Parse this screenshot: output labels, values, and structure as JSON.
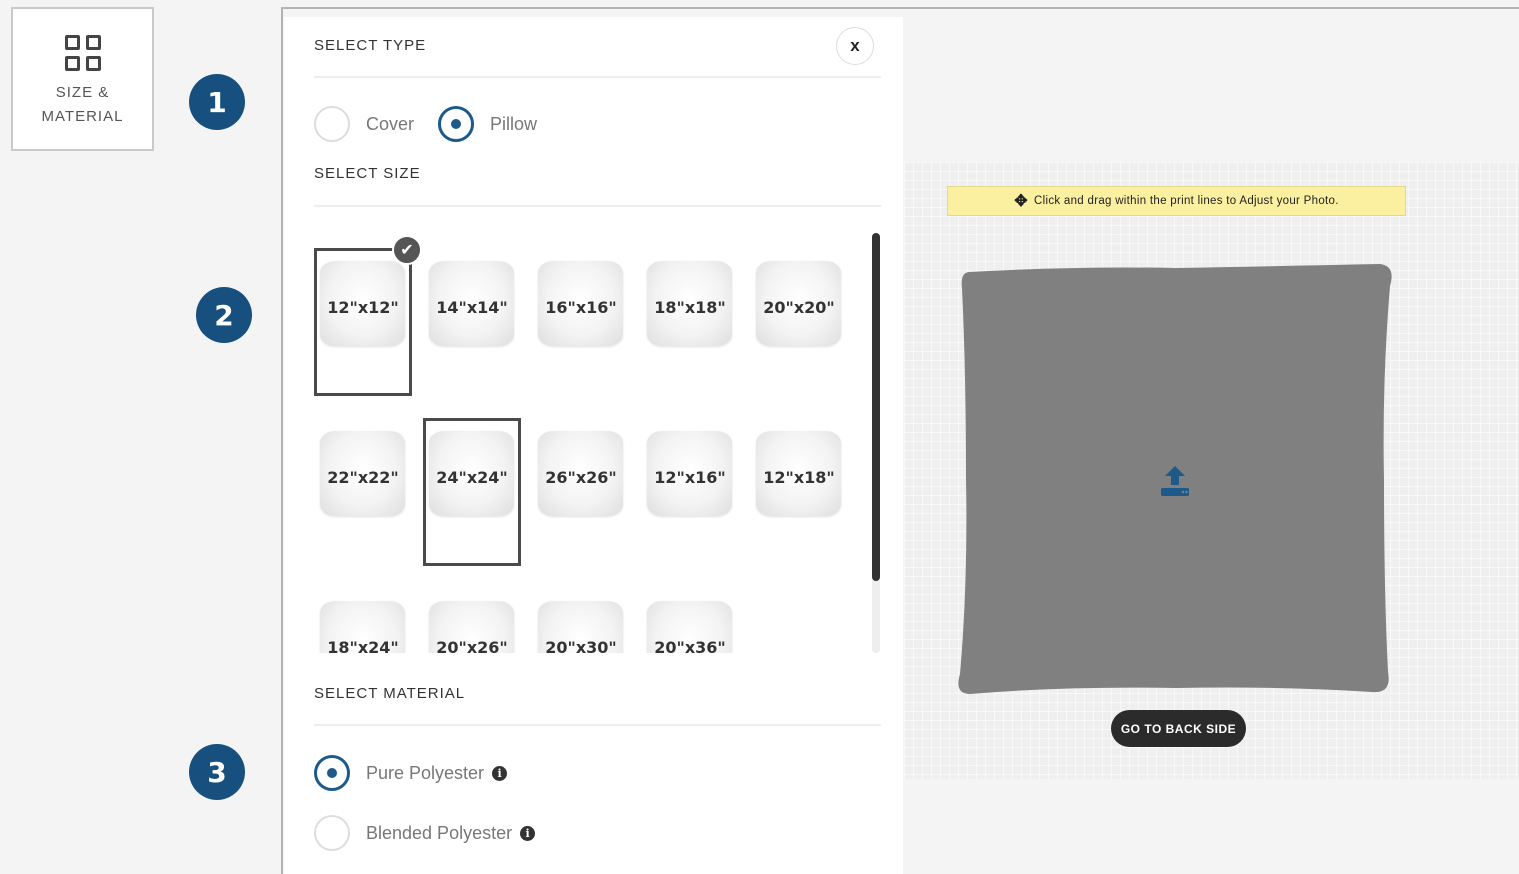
{
  "nav": {
    "size_material_label": "SIZE & MATERIAL",
    "icon": "grid-icon"
  },
  "steps": [
    "1",
    "2",
    "3"
  ],
  "panel": {
    "select_type_title": "SELECT TYPE",
    "close_label": "x",
    "types": [
      {
        "label": "Cover",
        "checked": false
      },
      {
        "label": "Pillow",
        "checked": true
      }
    ],
    "select_size_title": "SELECT SIZE",
    "sizes": [
      {
        "label": "12\"x12\"",
        "selected": true,
        "checked_mark": true
      },
      {
        "label": "14\"x14\"",
        "selected": false
      },
      {
        "label": "16\"x16\"",
        "selected": false
      },
      {
        "label": "18\"x18\"",
        "selected": false
      },
      {
        "label": "20\"x20\"",
        "selected": false
      },
      {
        "label": "22\"x22\"",
        "selected": false
      },
      {
        "label": "24\"x24\"",
        "selected": true
      },
      {
        "label": "26\"x26\"",
        "selected": false
      },
      {
        "label": "12\"x16\"",
        "selected": false
      },
      {
        "label": "12\"x18\"",
        "selected": false
      },
      {
        "label": "18\"x24\"",
        "selected": false
      },
      {
        "label": "20\"x26\"",
        "selected": false
      },
      {
        "label": "20\"x30\"",
        "selected": false
      },
      {
        "label": "20\"x36\"",
        "selected": false
      }
    ],
    "select_material_title": "SELECT MATERIAL",
    "materials": [
      {
        "label": "Pure Polyester",
        "checked": true
      },
      {
        "label": "Blended Polyester",
        "checked": false
      }
    ],
    "info_icon": "info-icon"
  },
  "canvas": {
    "hint": "Click and drag within the print lines to Adjust your Photo.",
    "hint_icon": "move-icon",
    "pillow_color": "#808080",
    "upload_icon": "upload-icon",
    "upload_color": "#1d5a8a",
    "back_button": "GO TO BACK SIDE"
  }
}
